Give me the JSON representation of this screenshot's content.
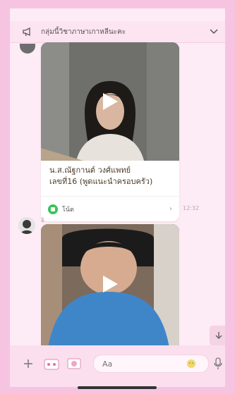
{
  "header": {
    "title": "กลุ่มนี้วิชาภาษาเกาหลีนะคะ"
  },
  "messages": [
    {
      "type": "video",
      "caption_line1": "น.ส.ณัฐกานต์ วงศ์แพทย์",
      "caption_line2": "เลขที่16 (พูดแนะนำครอบครัว)",
      "note_label": "โน้ต",
      "time": "12:32"
    },
    {
      "type": "video",
      "sender": "อิ"
    }
  ],
  "composer": {
    "placeholder": "Aa"
  },
  "colors": {
    "frame": "#f6c4e1",
    "background": "#fdebf5",
    "note_green": "#3bc15a"
  },
  "icons": [
    "megaphone-icon",
    "chevron-down-icon",
    "play-icon",
    "plus-icon",
    "sticker-icon",
    "photo-icon",
    "emoji-icon",
    "microphone-icon",
    "arrow-down-icon"
  ]
}
